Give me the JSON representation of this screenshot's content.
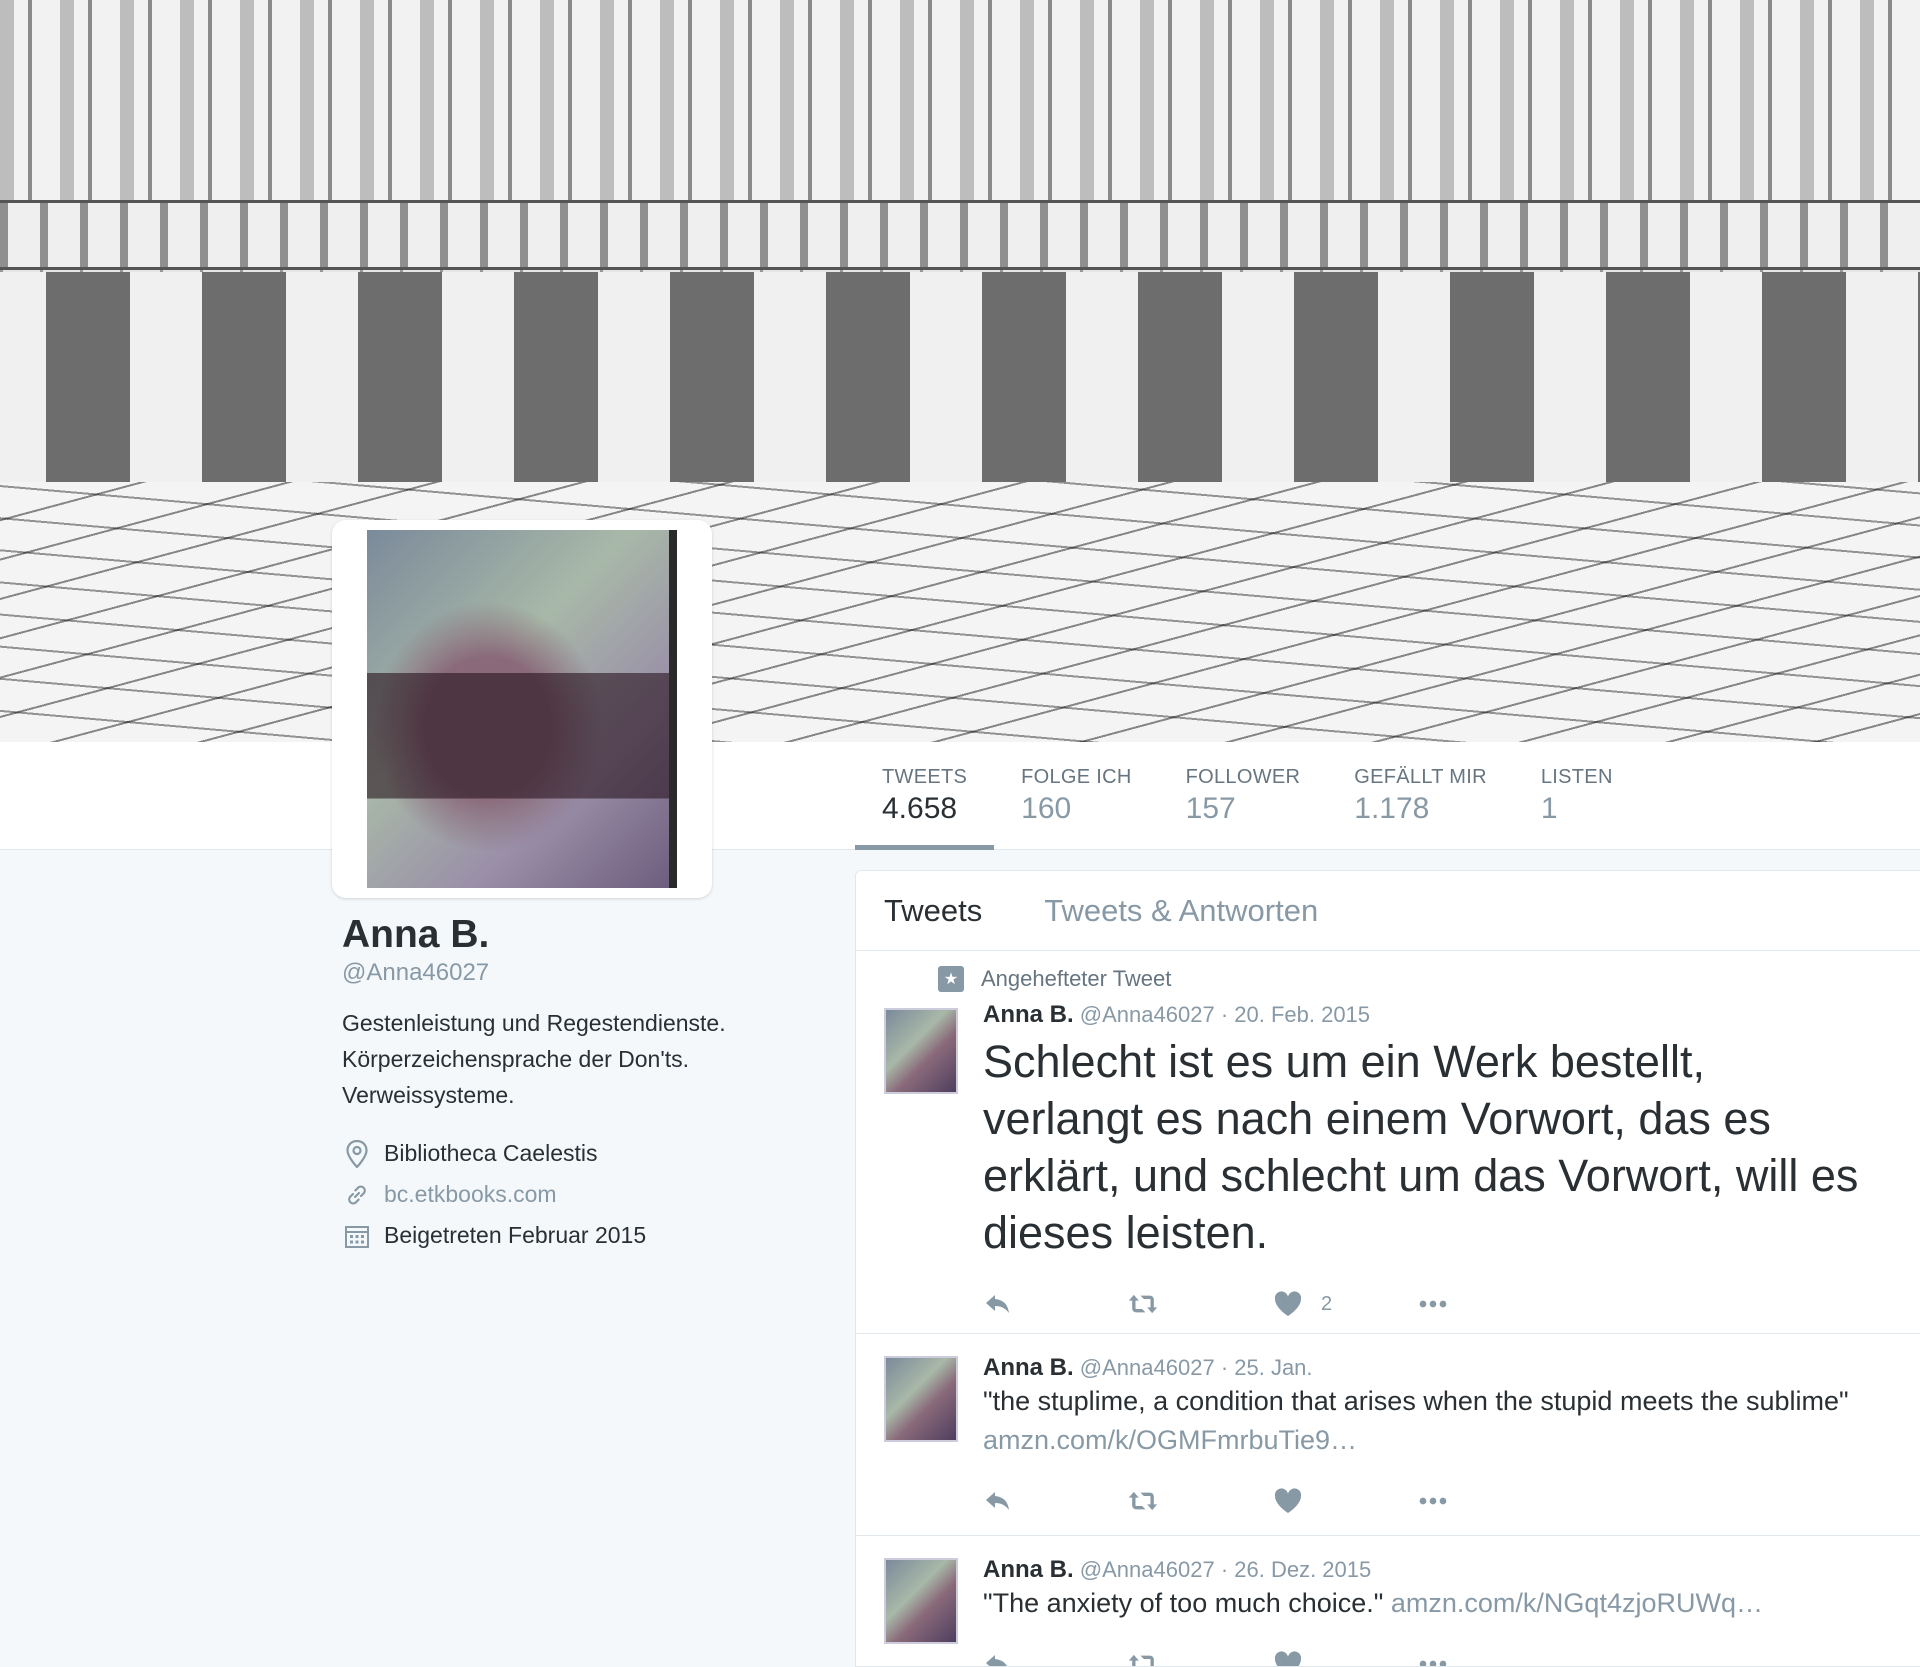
{
  "profile": {
    "name": "Anna B.",
    "handle": "@Anna46027",
    "bio": "Gestenleistung und Regestendienste.\nKörperzeichensprache der Don'ts.\nVerweissysteme.",
    "location": "Bibliotheca Caelestis",
    "website": "bc.etkbooks.com",
    "joined": "Beigetreten Februar 2015"
  },
  "stats": [
    {
      "label": "TWEETS",
      "value": "4.658"
    },
    {
      "label": "FOLGE ICH",
      "value": "160"
    },
    {
      "label": "FOLLOWER",
      "value": "157"
    },
    {
      "label": "GEFÄLLT MIR",
      "value": "1.178"
    },
    {
      "label": "LISTEN",
      "value": "1"
    }
  ],
  "tabs": [
    "Tweets",
    "Tweets & Antworten"
  ],
  "pinned_label": "Angehefteter Tweet",
  "tweets": [
    {
      "name": "Anna B.",
      "handle": "@Anna46027",
      "date": "· 20. Feb. 2015",
      "text": "Schlecht ist es um ein Werk bestellt, verlangt es nach einem Vorwort, das es erklärt, und schlecht um das Vorwort, will es dieses leisten.",
      "link": "",
      "likes": "2"
    },
    {
      "name": "Anna B.",
      "handle": "@Anna46027",
      "date": "· 25. Jan.",
      "text": "\"the stuplime, a condition that arises when the stupid meets the sublime\"",
      "link": "amzn.com/k/OGMFmrbuTie9…",
      "likes": ""
    },
    {
      "name": "Anna B.",
      "handle": "@Anna46027",
      "date": "· 26. Dez. 2015",
      "text": "\"The anxiety of too much choice.\"",
      "link": "amzn.com/k/NGqt4zjoRUWq…",
      "likes": ""
    }
  ]
}
